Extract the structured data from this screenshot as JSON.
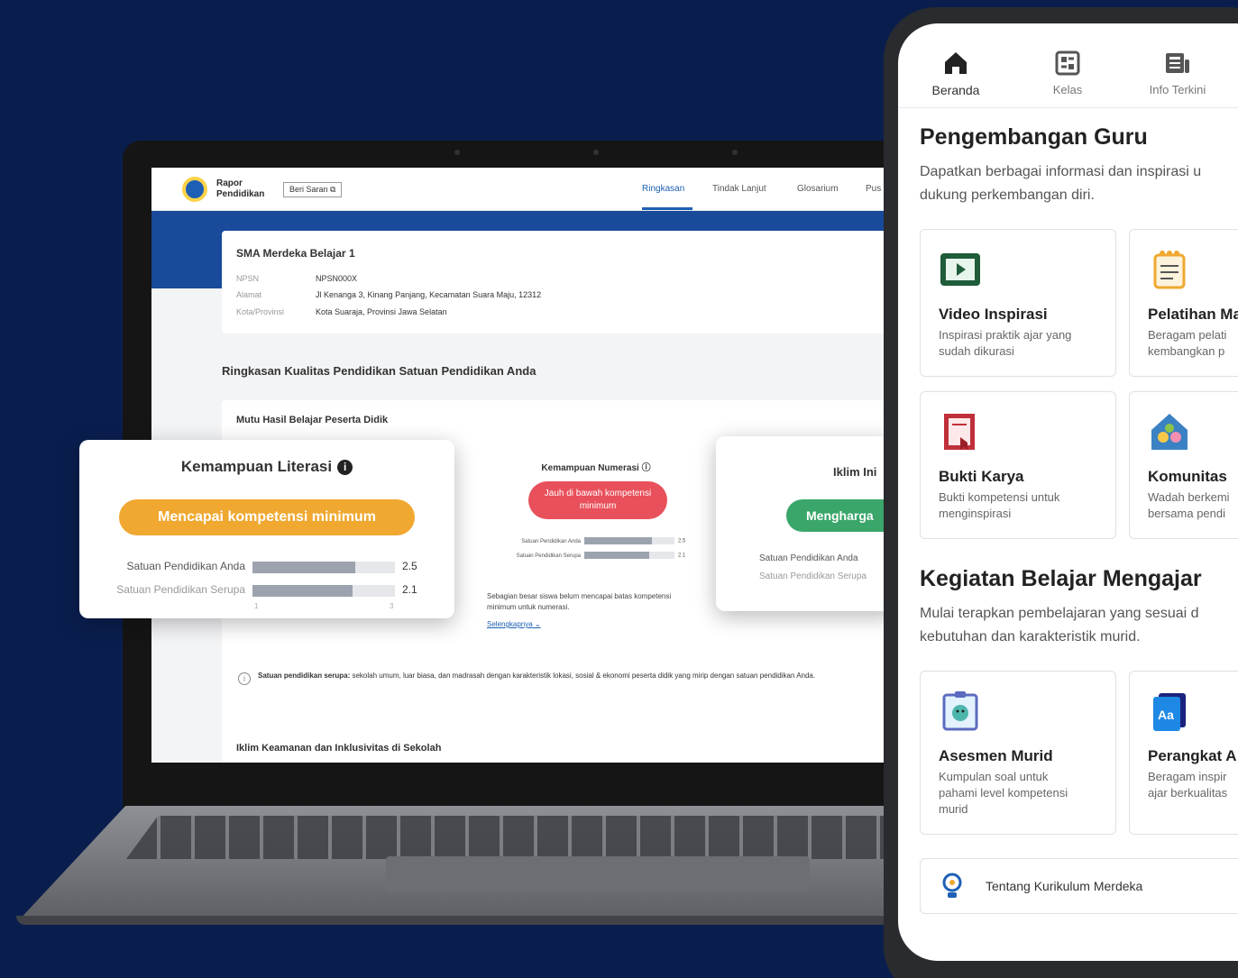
{
  "laptop": {
    "brand": "Rapor\nPendidikan",
    "feedback_button": "Beri Saran",
    "tabs": [
      "Ringkasan",
      "Tindak Lanjut",
      "Glosarium",
      "Pus"
    ],
    "school": {
      "name": "SMA Merdeka Belajar 1",
      "rows": [
        {
          "key": "NPSN",
          "value": "NPSN000X"
        },
        {
          "key": "Alamat",
          "value": "Jl Kenanga 3, Kinang Panjang, Kecamatan Suara Maju, 12312"
        },
        {
          "key": "Kota/Provinsi",
          "value": "Kota Suaraja, Provinsi Jawa Selatan"
        }
      ]
    },
    "summary_title": "Ringkasan Kualitas Pendidikan Satuan Pendidikan Anda",
    "mutu_title": "Mutu Hasil Belajar Peserta Didik",
    "numerasi": {
      "title": "Kemampuan Numerasi",
      "status": "Jauh di bawah kompetensi minimum",
      "rows": [
        {
          "label": "Satuan Pendidikan Anda",
          "value": "2.5",
          "fill": 0.75
        },
        {
          "label": "Satuan Pendidikan Serupa",
          "value": "2.1",
          "fill": 0.72
        }
      ],
      "note": "Sebagian besar siswa belum mencapai batas kompetensi minimum untuk numerasi.",
      "link": "Selengkapnya"
    },
    "info_label": "Satuan pendidikan serupa:",
    "info_text": " sekolah umum, luar biasa, dan madrasah dengan karakteristik lokasi, sosial & ekonomi peserta didik yang mirip dengan satuan pendidikan Anda.",
    "iklim_section_title": "Iklim Keamanan dan Inklusivitas di Sekolah"
  },
  "literasi_card": {
    "title": "Kemampuan Literasi",
    "status": "Mencapai kompetensi minimum",
    "status_color": "#f0a830",
    "rows": [
      {
        "label": "Satuan Pendidikan Anda",
        "value": "2.5",
        "fill": 0.72
      },
      {
        "label": "Satuan Pendidikan Serupa",
        "value": "2.1",
        "fill": 0.7
      }
    ],
    "ticks": [
      "1",
      "3"
    ]
  },
  "iklim_card": {
    "title": "Iklim Ini",
    "status": "Mengharga",
    "status_color": "#3aa66a",
    "rows": [
      "Satuan Pendidikan Anda",
      "Satuan Pendidikan Serupa"
    ]
  },
  "phone": {
    "nav": [
      {
        "label": "Beranda",
        "icon": "home-icon"
      },
      {
        "label": "Kelas",
        "icon": "class-icon"
      },
      {
        "label": "Info Terkini",
        "icon": "news-icon"
      }
    ],
    "sections": [
      {
        "title": "Pengembangan Guru",
        "subtitle": "Dapatkan berbagai informasi dan inspirasi u\ndukung perkembangan diri.",
        "cards": [
          {
            "title": "Video Inspirasi",
            "desc": "Inspirasi praktik ajar yang\nsudah dikurasi",
            "icon": "video-icon"
          },
          {
            "title": "Pelatihan Ma",
            "desc": "Beragam pelati\nkembangkan p",
            "icon": "notebook-icon"
          },
          {
            "title": "Bukti Karya",
            "desc": "Bukti kompetensi untuk\nmenginspirasi",
            "icon": "certificate-icon"
          },
          {
            "title": "Komunitas",
            "desc": "Wadah berkemi\nbersama pendi",
            "icon": "community-icon"
          }
        ]
      },
      {
        "title": "Kegiatan Belajar Mengajar",
        "subtitle": "Mulai terapkan pembelajaran yang sesuai d\nkebutuhan dan karakteristik murid.",
        "cards": [
          {
            "title": "Asesmen Murid",
            "desc": "Kumpulan soal untuk\npahami level kompetensi\nmurid",
            "icon": "assessment-icon"
          },
          {
            "title": "Perangkat A",
            "desc": "Beragam inspir\najar berkualitas",
            "icon": "book-icon"
          }
        ]
      }
    ],
    "banner": "Tentang Kurikulum Merdeka"
  }
}
